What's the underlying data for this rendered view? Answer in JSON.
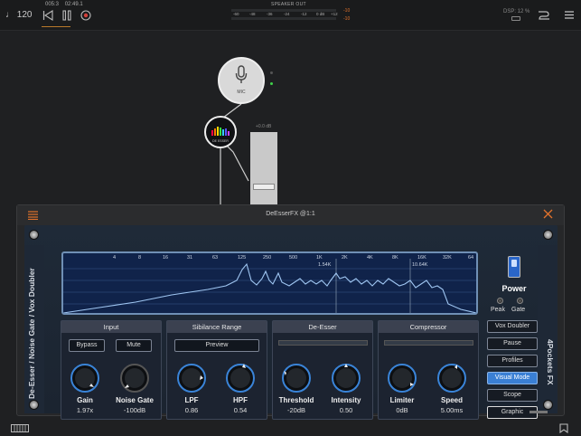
{
  "topbar": {
    "tempo": "♩ 120",
    "position_bars": "005:3",
    "position_time": "02:49.1",
    "meter_title": "SPEAKER OUT",
    "meter_scale": [
      "-60",
      "-48",
      "-36",
      "-24",
      "-12",
      "0 dB",
      "+12"
    ],
    "meter_left_value": "-10",
    "meter_right_value": "-10",
    "dsp_label": "DSP: 12 %"
  },
  "graph": {
    "mic_label": "MIC",
    "fx_label": "DE ESSER",
    "fader_db": "+0.0 dB"
  },
  "plugin": {
    "title": "DeEsserFX @1:1",
    "left_label": "De-Esser / Noise Gate / Vox Doubler",
    "right_label": "4Pockets FX",
    "analyzer": {
      "freq_labels": [
        "4",
        "8",
        "16",
        "31",
        "63",
        "125",
        "250",
        "500",
        "1K",
        "2K",
        "4K",
        "8K",
        "16K",
        "32K",
        "64"
      ],
      "marker1": "1.54K",
      "marker2": "10.64K"
    },
    "power_label": "Power",
    "peak_label": "Peak",
    "gate_label": "Gate",
    "sections": {
      "input": {
        "title": "Input",
        "bypass": "Bypass",
        "mute": "Mute",
        "gain_label": "Gain",
        "gain_value": "1.97x",
        "noise_gate_label": "Noise Gate",
        "noise_gate_value": "-100dB"
      },
      "sibilance": {
        "title": "Sibilance Range",
        "preview": "Preview",
        "lpf_label": "LPF",
        "lpf_value": "0.86",
        "hpf_label": "HPF",
        "hpf_value": "0.54"
      },
      "deesser": {
        "title": "De-Esser",
        "threshold_label": "Threshold",
        "threshold_value": "-20dB",
        "intensity_label": "Intensity",
        "intensity_value": "0.50"
      },
      "compressor": {
        "title": "Compressor",
        "limiter_label": "Limiter",
        "limiter_value": "0dB",
        "speed_label": "Speed",
        "speed_value": "5.00ms"
      }
    },
    "right_buttons": {
      "vox_doubler": "Vox Doubler",
      "pause": "Pause",
      "profiles": "Profiles",
      "visual_mode": "Visual Mode",
      "scope": "Scope",
      "graphic": "Graphic"
    }
  },
  "colors": {
    "accent_blue": "#3a7fd4",
    "meter_orange": "#e0722c",
    "analyzer_bg": "#10234a",
    "led_green": "#3fd24a"
  }
}
